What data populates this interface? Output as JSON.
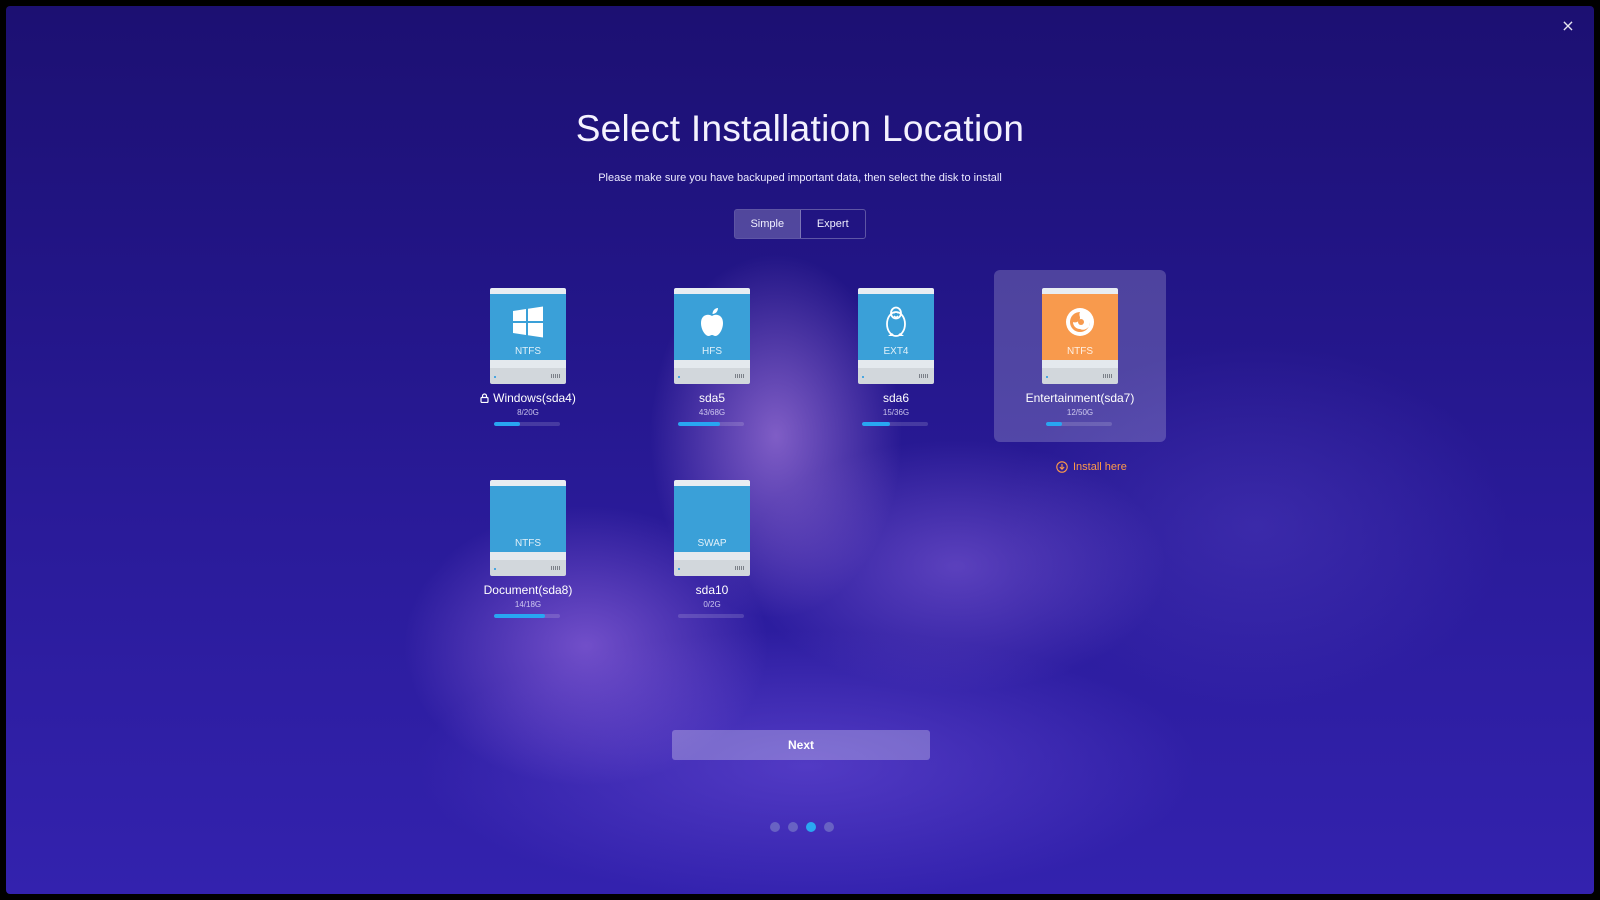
{
  "window": {
    "close_label": "×"
  },
  "header": {
    "title": "Select Installation Location",
    "subtitle": "Please make sure you have backuped important data, then select the disk to install"
  },
  "mode_switch": {
    "simple_label": "Simple",
    "expert_label": "Expert",
    "selected": "Simple"
  },
  "disks": [
    {
      "name": "Windows(sda4)",
      "filesystem": "NTFS",
      "size": "8/20G",
      "usage": 0.4,
      "icon": "windows-logo-icon",
      "locked": true
    },
    {
      "name": "sda5",
      "filesystem": "HFS",
      "size": "43/68G",
      "usage": 0.63,
      "icon": "apple-logo-icon",
      "locked": false
    },
    {
      "name": "sda6",
      "filesystem": "EXT4",
      "size": "15/36G",
      "usage": 0.42,
      "icon": "linux-tux-icon",
      "locked": false
    },
    {
      "name": "Entertainment(sda7)",
      "filesystem": "NTFS",
      "size": "12/50G",
      "usage": 0.24,
      "icon": "deepin-logo-icon",
      "locked": false,
      "selected": true
    },
    {
      "name": "Document(sda8)",
      "filesystem": "NTFS",
      "size": "14/18G",
      "usage": 0.78,
      "icon": "",
      "locked": false
    },
    {
      "name": "sda10",
      "filesystem": "SWAP",
      "size": "0/2G",
      "usage": 0.0,
      "icon": "",
      "locked": false
    }
  ],
  "install_here": {
    "label": "Install here",
    "icon": "download-circle-icon"
  },
  "footer": {
    "next_label": "Next"
  },
  "pager": {
    "total": 4,
    "current": 3
  },
  "colors": {
    "accent": "#2aa8f2",
    "selected_drive": "#f89a4d",
    "drive": "#3aa0d8",
    "install_here": "#fd9a4a"
  }
}
